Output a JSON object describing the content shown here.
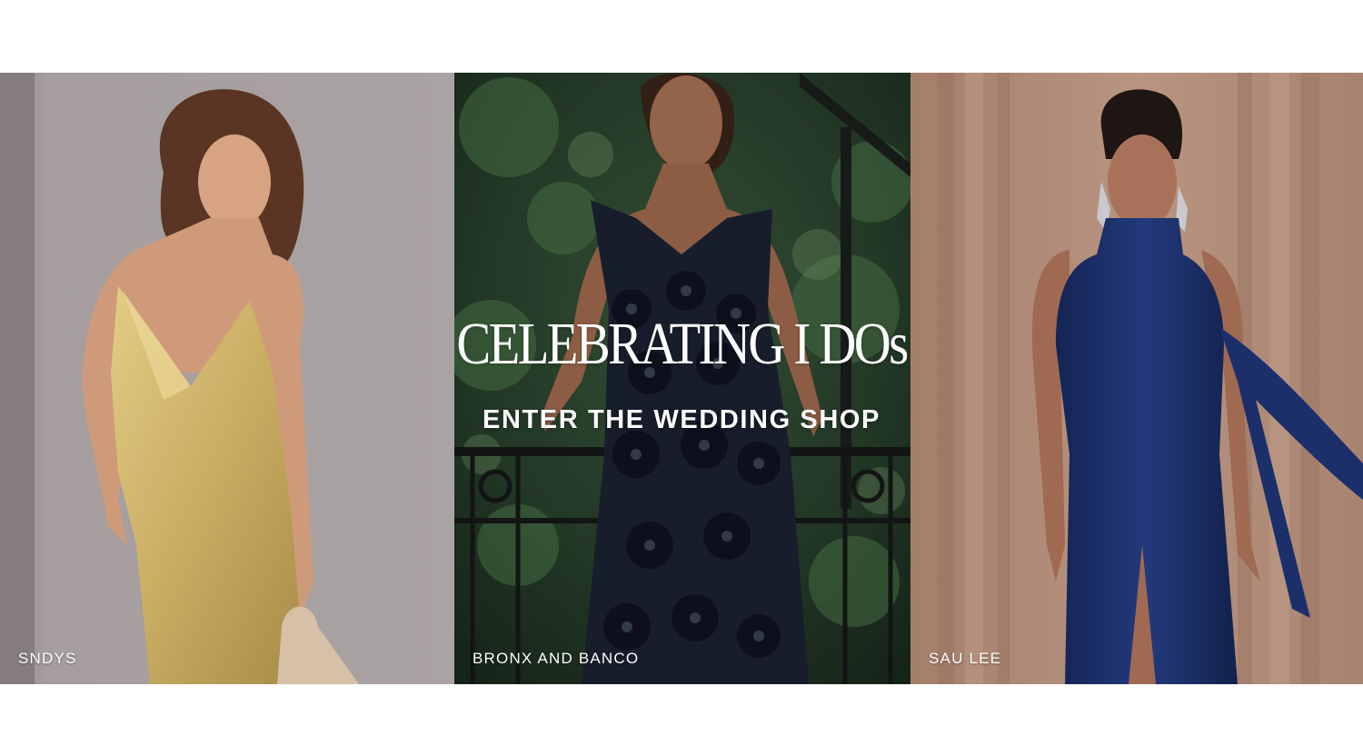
{
  "banner": {
    "headline": "CELEBRATING I DOs",
    "cta": "ENTER THE WEDDING SHOP",
    "panels": [
      {
        "brand": "SNDYS",
        "dress_color": "#c9ad63",
        "backdrop_color": "#a39b9b"
      },
      {
        "brand": "BRONX AND BANCO",
        "dress_color": "#1c2233",
        "backdrop_color": "#2f4a32"
      },
      {
        "brand": "SAU LEE",
        "dress_color": "#1b2f6b",
        "backdrop_color": "#b08c77"
      }
    ]
  }
}
